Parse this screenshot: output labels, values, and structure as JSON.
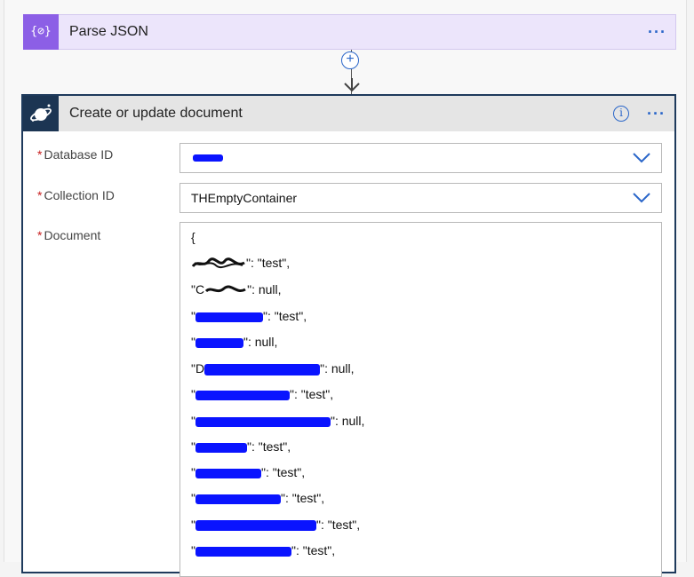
{
  "parse_step": {
    "title": "Parse JSON",
    "more": "···",
    "icon": "{⊘}"
  },
  "connector": {
    "add_symbol": "+"
  },
  "doc_step": {
    "title": "Create or update document",
    "info": "i",
    "more": "···",
    "fields": {
      "database_id": {
        "label": "Database ID",
        "value": ""
      },
      "collection_id": {
        "label": "Collection ID",
        "value": "THEmptyContainer"
      },
      "document": {
        "label": "Document"
      }
    },
    "required_marker": "*",
    "document_lines": [
      {
        "pre": "{",
        "post": ""
      },
      {
        "pre": "\"",
        "post": "\": \"test\","
      },
      {
        "pre": "\"C",
        "post": "\": null,"
      },
      {
        "pre": "\"",
        "post": "\": \"test\","
      },
      {
        "pre": "\"",
        "post": "\": null,"
      },
      {
        "pre": "\"D",
        "post": "\": null,"
      },
      {
        "pre": "\"",
        "post": "\": \"test\","
      },
      {
        "pre": "\"",
        "post": "\": null,"
      },
      {
        "pre": "\"",
        "post": "\": \"test\","
      },
      {
        "pre": "\"",
        "post": "\": \"test\","
      },
      {
        "pre": "\"",
        "post": "\": \"test\","
      },
      {
        "pre": "\"",
        "post": "\": \"test\","
      },
      {
        "pre": "\"",
        "post": "\": \"test\","
      }
    ]
  },
  "colors": {
    "accent": "#2a66c9",
    "parse_icon_bg": "#8c5fe6",
    "cosmos_icon_bg": "#1c3553",
    "required": "#c81e1e",
    "redaction": "#0a14ff"
  }
}
